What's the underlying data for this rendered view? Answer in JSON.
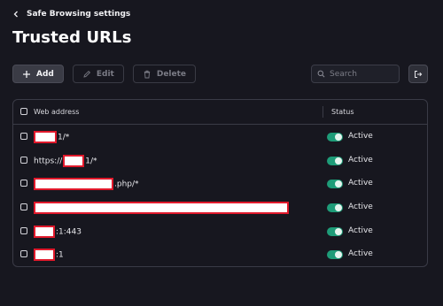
{
  "header": {
    "back_label": "Safe Browsing settings",
    "title": "Trusted URLs"
  },
  "toolbar": {
    "add_label": "Add",
    "edit_label": "Edit",
    "delete_label": "Delete",
    "search_placeholder": "Search"
  },
  "table": {
    "columns": {
      "web_address": "Web address",
      "status": "Status"
    },
    "rows": [
      {
        "prefix": "",
        "suffix": "1/*",
        "status": "Active",
        "enabled": true
      },
      {
        "prefix": "https://",
        "suffix": "1/*",
        "status": "Active",
        "enabled": true
      },
      {
        "prefix": "",
        "suffix": ".php/*",
        "status": "Active",
        "enabled": true
      },
      {
        "prefix": "",
        "suffix": "",
        "status": "Active",
        "enabled": true
      },
      {
        "prefix": "",
        "suffix": ":1:443",
        "status": "Active",
        "enabled": true
      },
      {
        "prefix": "",
        "suffix": ":1",
        "status": "Active",
        "enabled": true
      }
    ]
  },
  "colors": {
    "background": "#17171f",
    "toggle_on": "#1e9c78",
    "redaction_border": "#e0192b"
  },
  "icons": [
    "chevron-left-icon",
    "plus-icon",
    "pencil-icon",
    "trash-icon",
    "search-icon",
    "export-icon"
  ]
}
